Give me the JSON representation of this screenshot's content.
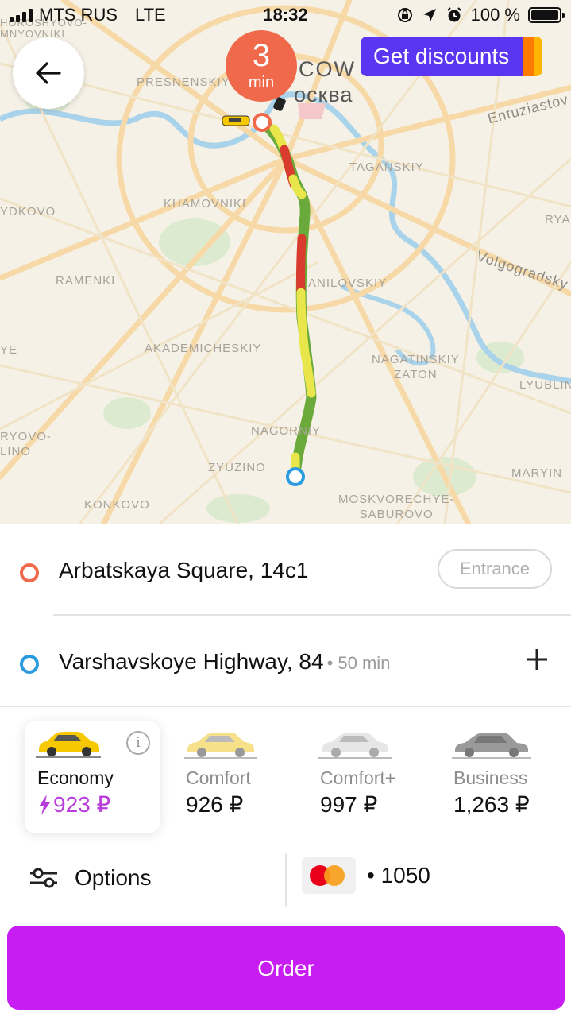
{
  "status_bar": {
    "carrier": "MTS RUS",
    "network": "LTE",
    "time": "18:32",
    "battery": "100 %"
  },
  "map": {
    "districts": [
      {
        "id": "horoshyovo",
        "text": "HOROSHYOVO-\nMNYOVNIKI"
      },
      {
        "id": "presnensky",
        "text": "PRESNENSKIY"
      },
      {
        "id": "moscow",
        "text": "COW"
      },
      {
        "id": "moskva",
        "text": "осква"
      },
      {
        "id": "entuziastov",
        "text": "Entuziastov"
      },
      {
        "id": "taganskiy",
        "text": "TAGANSKIY"
      },
      {
        "id": "dorogomilovo",
        "text": "YDKOVO"
      },
      {
        "id": "khamovniki",
        "text": "KHAMOVNIKI"
      },
      {
        "id": "rya",
        "text": "RYA"
      },
      {
        "id": "volgogradsky",
        "text": "Volgogradsky"
      },
      {
        "id": "ramenki",
        "text": "RAMENKI"
      },
      {
        "id": "danilovskiy",
        "text": "ANILOVSKIY"
      },
      {
        "id": "ye",
        "text": "YE"
      },
      {
        "id": "akademicheskiy",
        "text": "AKADEMICHESKIY"
      },
      {
        "id": "nagatinsky",
        "text": "NAGATINSKIY\nZATON"
      },
      {
        "id": "lyublino",
        "text": "LYUBLIN"
      },
      {
        "id": "troparevo",
        "text": "RYOVO-\nLINO"
      },
      {
        "id": "nagorny",
        "text": "NAGORNIY"
      },
      {
        "id": "zyuzino",
        "text": "ZYUZINO"
      },
      {
        "id": "maryino",
        "text": "MARYIN"
      },
      {
        "id": "konkovo",
        "text": "KONKOVO"
      },
      {
        "id": "moskvorechye",
        "text": "MOSKVORECHYE-\nSABUROVO"
      }
    ],
    "eta_value": "3",
    "eta_unit": "min",
    "discount_label": "Get discounts"
  },
  "route": {
    "from": "Arbatskaya Square, 14с1",
    "from_button": "Entrance",
    "to": "Varshavskoye Highway, 84",
    "to_duration": "• 50 min"
  },
  "tariffs": [
    {
      "name": "Economy",
      "price": "923 ₽",
      "selected": true,
      "car_color": "#f5c800"
    },
    {
      "name": "Comfort",
      "price": "926 ₽",
      "selected": false,
      "car_color": "#f7e08a"
    },
    {
      "name": "Comfort+",
      "price": "997 ₽",
      "selected": false,
      "car_color": "#e6e6e6"
    },
    {
      "name": "Business",
      "price": "1,263 ₽",
      "selected": false,
      "car_color": "#9a9a9a"
    }
  ],
  "options_label": "Options",
  "payment": {
    "card_suffix": "• 1050"
  },
  "order_label": "Order",
  "colors": {
    "accent": "#c81df2",
    "eta": "#f0694a",
    "discount": "#5b36f2",
    "origin": "#f0694a",
    "destination": "#2a9be0"
  }
}
